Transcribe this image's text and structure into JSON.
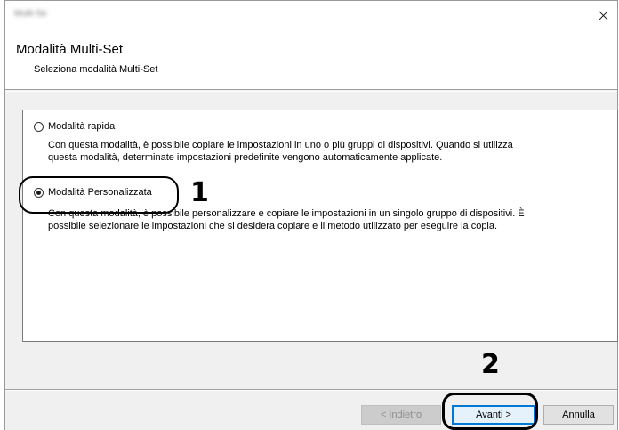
{
  "window": {
    "title": "Multi-Set"
  },
  "header": {
    "title": "Modalità Multi-Set",
    "subtitle": "Seleziona modalità Multi-Set"
  },
  "options": [
    {
      "label": "Modalità rapida",
      "checked": false,
      "description_line1": "Con questa modalità, è possibile copiare le impostazioni in uno o più gruppi di dispositivi. Quando si utilizza",
      "description_line2": "questa modalità, determinate impostazioni predefinite vengono automaticamente applicate."
    },
    {
      "label": "Modalità Personalizzata",
      "checked": true,
      "description_line1": "Con questa modalità, è possibile personalizzare e copiare le impostazioni in un singolo gruppo di dispositivi. È",
      "description_line2": "possibile selezionare le impostazioni che si desidera copiare e il metodo utilizzato per eseguire la copia."
    }
  ],
  "callouts": {
    "step1": "1",
    "step2": "2"
  },
  "buttons": {
    "back": "< Indietro",
    "next": "Avanti >",
    "cancel": "Annulla"
  }
}
